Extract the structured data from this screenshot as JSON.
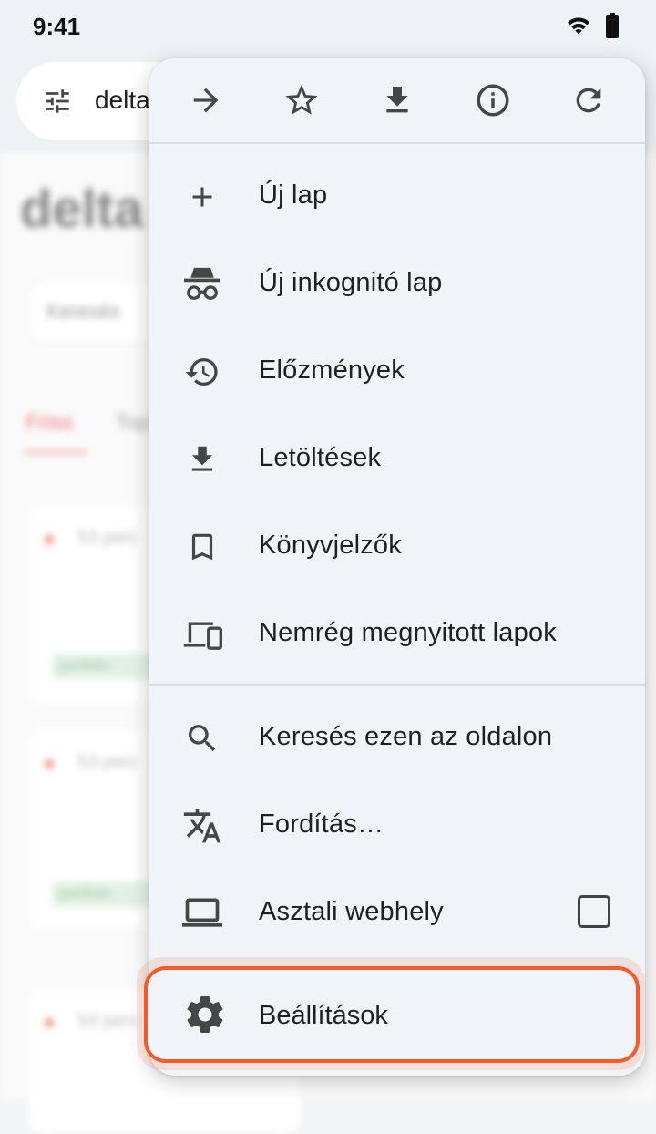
{
  "status_bar": {
    "time": "9:41",
    "icons": [
      "wifi-icon",
      "battery-icon"
    ]
  },
  "toolbar": {
    "url_text": "delta",
    "icons": [
      "tune-icon"
    ]
  },
  "page": {
    "title": "delta",
    "search_text": "Keresés",
    "tab1": "Friss",
    "tab2": "Top",
    "card_text": "53 perc",
    "card_tag": "portfolio"
  },
  "menu": {
    "top_icons": [
      "forward-icon",
      "star-icon",
      "download-icon",
      "info-icon",
      "refresh-icon"
    ],
    "items": [
      {
        "label": "Új lap",
        "icon": "plus-icon"
      },
      {
        "label": "Új inkognitó lap",
        "icon": "incognito-icon"
      },
      {
        "label": "Előzmények",
        "icon": "history-icon"
      },
      {
        "label": "Letöltések",
        "icon": "download-icon"
      },
      {
        "label": "Könyvjelzők",
        "icon": "bookmark-icon"
      },
      {
        "label": "Nemrég megnyitott lapok",
        "icon": "devices-icon"
      },
      {
        "label": "Keresés ezen az oldalon",
        "icon": "search-icon"
      },
      {
        "label": "Fordítás…",
        "icon": "translate-icon"
      },
      {
        "label": "Asztali webhely",
        "icon": "laptop-icon",
        "checked": false
      },
      {
        "label": "Beállítások",
        "icon": "gear-icon",
        "highlighted": true
      }
    ]
  },
  "colors": {
    "highlight": "#f25c2a",
    "menu_bg": "#f0f3f8",
    "icon": "#444746"
  }
}
